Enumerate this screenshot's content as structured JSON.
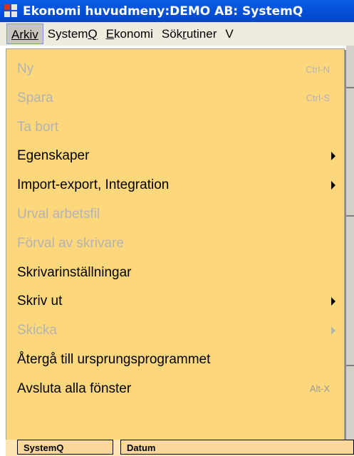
{
  "window": {
    "title": "Ekonomi huvudmeny:DEMO AB: SystemQ"
  },
  "menubar": {
    "items": [
      {
        "label": "Arkiv"
      },
      {
        "label": "SystemQ"
      },
      {
        "label": "Ekonomi"
      },
      {
        "label": "Sökrutiner"
      },
      {
        "label": "V"
      }
    ]
  },
  "dropdown": {
    "items": [
      {
        "label": "Ny",
        "shortcut": "Ctrl-N",
        "enabled": false,
        "submenu": false
      },
      {
        "label": "Spara",
        "shortcut": "Ctrl-S",
        "enabled": false,
        "submenu": false
      },
      {
        "label": "Ta bort",
        "shortcut": "",
        "enabled": false,
        "submenu": false
      },
      {
        "label": "Egenskaper",
        "shortcut": "",
        "enabled": true,
        "submenu": true
      },
      {
        "label": "Import-export, Integration",
        "shortcut": "",
        "enabled": true,
        "submenu": true
      },
      {
        "label": "Urval arbetsfil",
        "shortcut": "",
        "enabled": false,
        "submenu": false
      },
      {
        "label": "Förval av skrivare",
        "shortcut": "",
        "enabled": false,
        "submenu": false
      },
      {
        "label": "Skrivarinställningar",
        "shortcut": "",
        "enabled": true,
        "submenu": false
      },
      {
        "label": "Skriv ut",
        "shortcut": "",
        "enabled": true,
        "submenu": true
      },
      {
        "label": "Skicka",
        "shortcut": "",
        "enabled": false,
        "submenu": true
      },
      {
        "label": "Återgå till ursprungsprogrammet",
        "shortcut": "",
        "enabled": true,
        "submenu": false
      },
      {
        "label": "Avsluta alla fönster",
        "shortcut": "Alt-X",
        "enabled": true,
        "submenu": false
      }
    ]
  },
  "table": {
    "columns": [
      "SystemQ",
      "Datum"
    ]
  },
  "colors": {
    "titlebar": "#0553d9",
    "menu_background": "#fdd77c",
    "disabled_text": "#b3b3b3"
  }
}
